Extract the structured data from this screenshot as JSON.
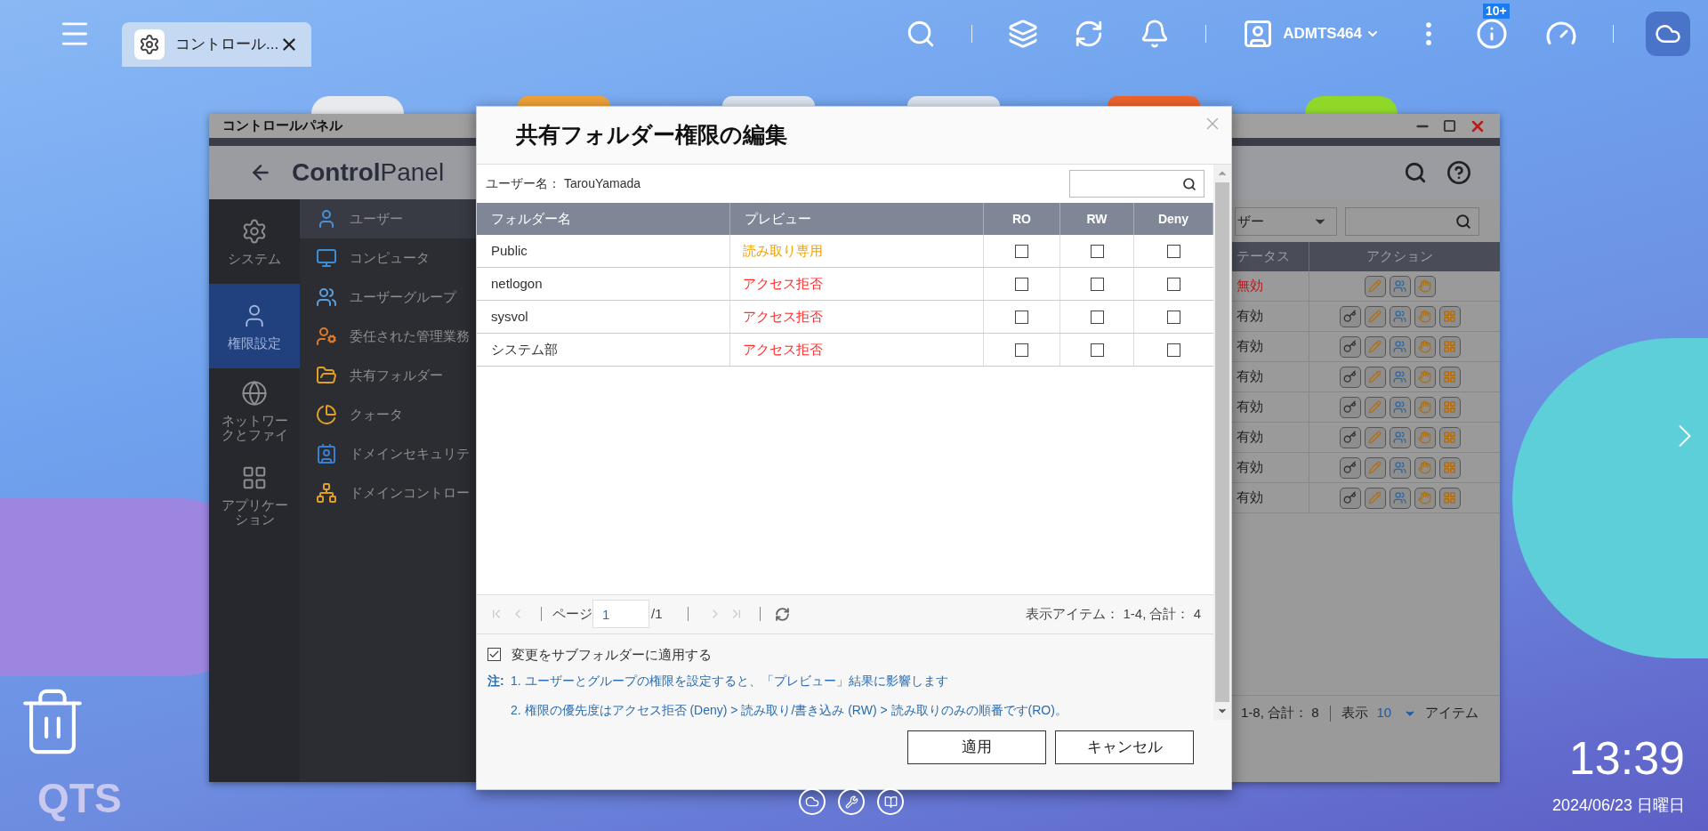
{
  "taskbar": {
    "tab": {
      "label": "コントロール...",
      "selected": true
    },
    "user": "ADMTS464",
    "notification_badge": "10+"
  },
  "control_panel": {
    "window_title": "コントロールパネル",
    "header": "**Control**Panel",
    "nav": [
      {
        "label": "システム",
        "selected": false
      },
      {
        "label": "権限設定",
        "selected": true
      },
      {
        "label": "ネットワークとファイ",
        "selected": false
      },
      {
        "label": "アプリケーション",
        "selected": false
      }
    ],
    "submenu": [
      {
        "label": "ユーザー",
        "selected": true
      },
      {
        "label": "コンピュータ",
        "selected": false
      },
      {
        "label": "ユーザーグループ",
        "selected": false
      },
      {
        "label": "委任された管理業務",
        "selected": false
      },
      {
        "label": "共有フォルダー",
        "selected": false
      },
      {
        "label": "クォータ",
        "selected": false
      },
      {
        "label": "ドメインセキュリテ",
        "selected": false
      },
      {
        "label": "ドメインコントロー",
        "selected": false
      }
    ],
    "filter": {
      "value": "ザー"
    },
    "table": {
      "columns": [
        "テータス",
        "アクション"
      ],
      "rows": [
        {
          "status": "無効",
          "disabled": true
        },
        {
          "status": "有効",
          "disabled": false
        },
        {
          "status": "有効",
          "disabled": false
        },
        {
          "status": "有効",
          "disabled": false
        },
        {
          "status": "有効",
          "disabled": false
        },
        {
          "status": "有効",
          "disabled": false
        },
        {
          "status": "有効",
          "disabled": false
        },
        {
          "status": "有効",
          "disabled": false
        }
      ]
    },
    "footer": {
      "range": "1-8, 合計： 8",
      "show_label": "表示",
      "page_size": "10",
      "unit": "アイテム"
    }
  },
  "dialog": {
    "title": "共有フォルダー権限の編集",
    "user_label": "ユーザー名：",
    "user_name": "TarouYamada",
    "columns": [
      "フォルダー名",
      "プレビュー",
      "RO",
      "RW",
      "Deny"
    ],
    "rows": [
      {
        "folder": "Public",
        "preview": "読み取り専用",
        "color": "#f5a000",
        "ro": false,
        "rw": false,
        "deny": false
      },
      {
        "folder": "netlogon",
        "preview": "アクセス拒否",
        "color": "#ff2a2a",
        "ro": false,
        "rw": false,
        "deny": false
      },
      {
        "folder": "sysvol",
        "preview": "アクセス拒否",
        "color": "#ff2a2a",
        "ro": false,
        "rw": false,
        "deny": false
      },
      {
        "folder": "システム部",
        "preview": "アクセス拒否",
        "color": "#ff2a2a",
        "ro": false,
        "rw": false,
        "deny": false
      }
    ],
    "pagination": {
      "page_label": "ページ",
      "page": "1",
      "total_pages": "/1",
      "summary": "表示アイテム： 1-4, 合計： 4"
    },
    "apply_subfolders": {
      "label": "変更をサブフォルダーに適用する",
      "checked": true
    },
    "note_label": "注:",
    "notes": [
      "1. ユーザーとグループの権限を設定すると、「プレビュー」結果に影響します",
      "2. 権限の優先度はアクセス拒否 (Deny) > 読み取り/書き込み (RW) > 読み取りのみの順番です(RO)。"
    ],
    "buttons": [
      "適用",
      "キャンセル"
    ]
  },
  "clock": {
    "time": "13:39",
    "date": "2024/06/23 日曜日"
  },
  "logo": "QTS"
}
